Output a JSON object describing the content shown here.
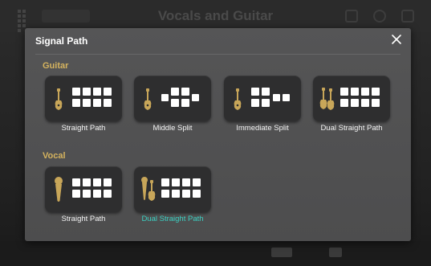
{
  "background": {
    "title": "Vocals and Guitar"
  },
  "dialog": {
    "title": "Signal Path",
    "accent_color": "#d5b35e",
    "selected_color": "#3bd1c2",
    "sections": [
      {
        "title": "Guitar",
        "options": [
          {
            "label": "Straight Path",
            "icon": "guitar-icon",
            "layout": "straight"
          },
          {
            "label": "Middle Split",
            "icon": "guitar-icon",
            "layout": "middle-split"
          },
          {
            "label": "Immediate Split",
            "icon": "guitar-icon",
            "layout": "immediate-split"
          },
          {
            "label": "Dual Straight Path",
            "icon": "dual-guitar-icon",
            "layout": "straight"
          }
        ]
      },
      {
        "title": "Vocal",
        "options": [
          {
            "label": "Straight Path",
            "icon": "microphone-icon",
            "layout": "straight"
          },
          {
            "label": "Dual Straight Path",
            "icon": "mic-and-guitar-icon",
            "layout": "straight",
            "selected": true
          }
        ]
      }
    ]
  }
}
